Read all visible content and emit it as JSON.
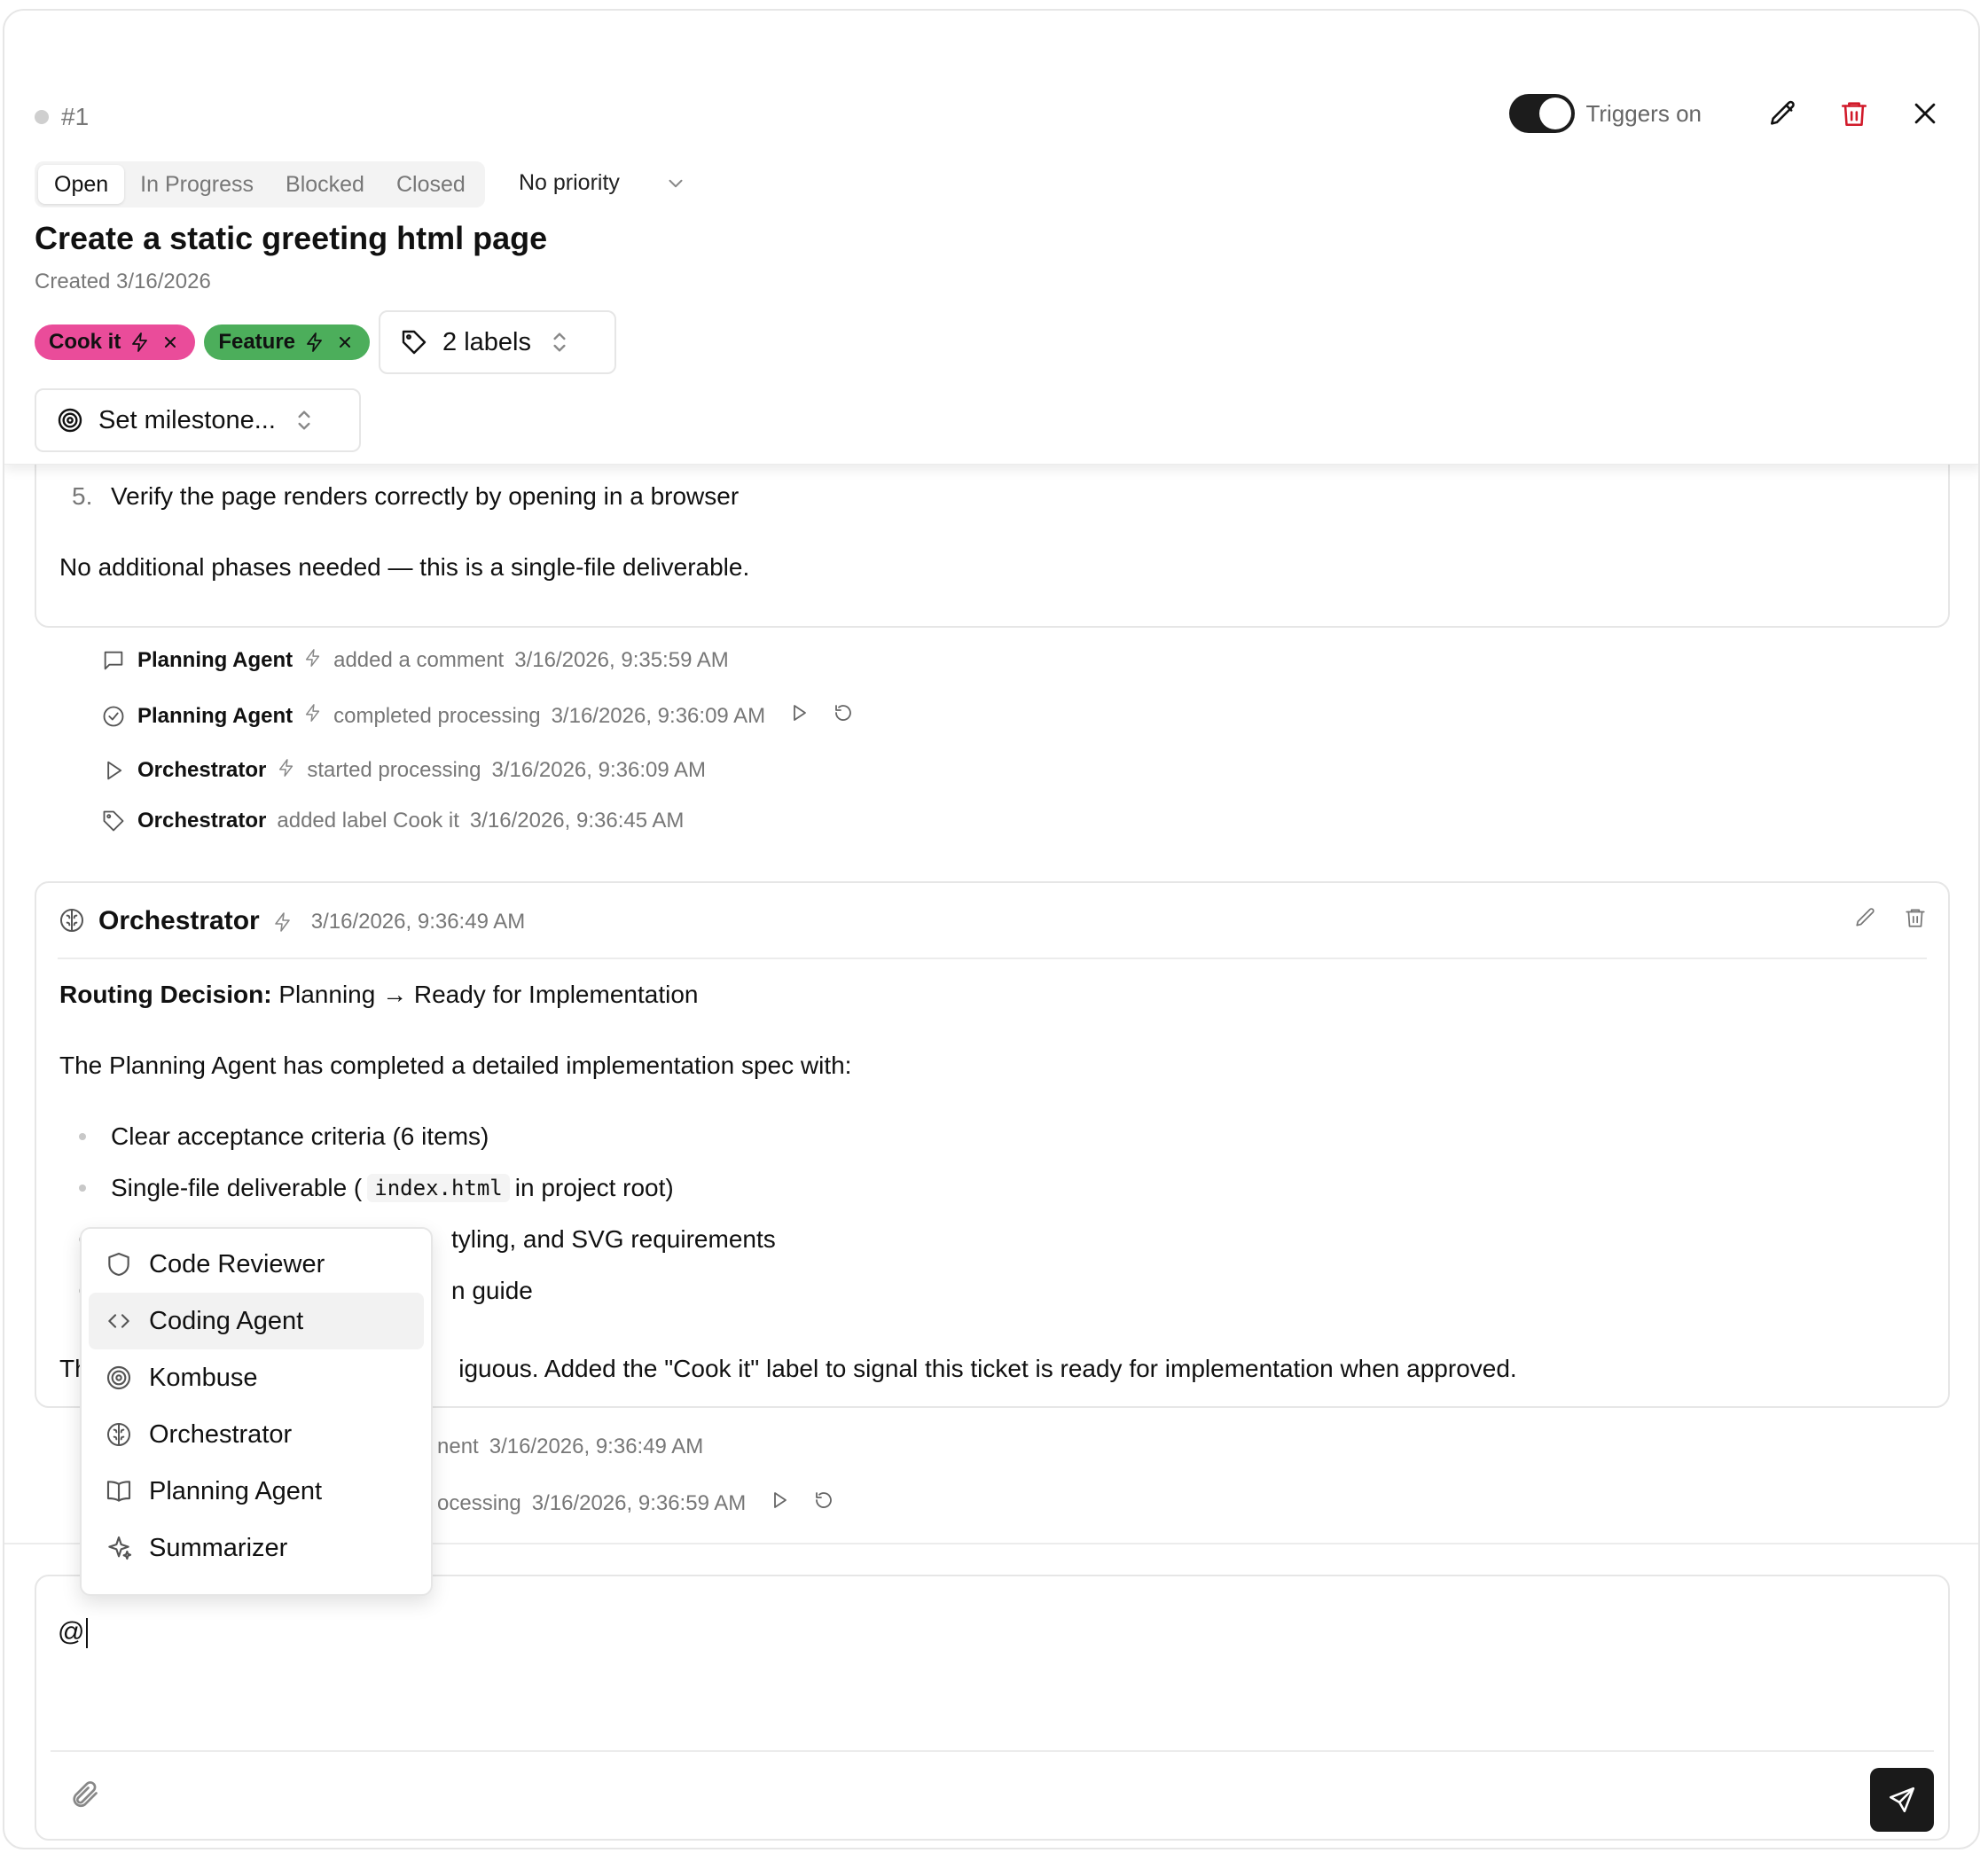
{
  "issue": {
    "id": "#1",
    "title": "Create a static greeting html page",
    "created": "Created 3/16/2026",
    "status_tabs": [
      "Open",
      "In Progress",
      "Blocked",
      "Closed"
    ],
    "active_status": "Open",
    "priority": "No priority"
  },
  "header": {
    "triggers_label": "Triggers on",
    "triggers_on": true
  },
  "labels": {
    "chips": [
      {
        "label": "Cook it",
        "color": "#ea4c9a"
      },
      {
        "label": "Feature",
        "color": "#4cae5b"
      }
    ],
    "summary": "2 labels"
  },
  "milestone": {
    "placeholder": "Set milestone..."
  },
  "plan_card": {
    "list_number": "5.",
    "list_text": "Verify the page renders correctly by opening in a browser",
    "closing": "No additional phases needed — this is a single-file deliverable."
  },
  "activity": [
    {
      "actor": "Planning Agent",
      "action": "added a comment",
      "time": "3/16/2026, 9:35:59 AM",
      "icon": "comment-icon"
    },
    {
      "actor": "Planning Agent",
      "action": "completed processing",
      "time": "3/16/2026, 9:36:09 AM",
      "icon": "check-circle-icon"
    },
    {
      "actor": "Orchestrator",
      "action": "started processing",
      "time": "3/16/2026, 9:36:09 AM",
      "icon": "play-icon"
    },
    {
      "actor": "Orchestrator",
      "action": "added label Cook it",
      "time": "3/16/2026, 9:36:45 AM",
      "icon": "tag-icon"
    }
  ],
  "comment": {
    "author": "Orchestrator",
    "time": "3/16/2026, 9:36:49 AM",
    "routing_label": "Routing Decision:",
    "routing_value": "Planning → Ready for Implementation",
    "intro": "The Planning Agent has completed a detailed implementation spec with:",
    "bullet1": "Clear acceptance criteria (6 items)",
    "bullet2_pre": "Single-file deliverable (",
    "bullet2_code": "index.html",
    "bullet2_post": "in project root)",
    "bullet3_visible": "tyling, and SVG requirements",
    "bullet4_visible": "n guide",
    "closing_prefix": "Th",
    "closing_visible": "iguous. Added the \"Cook it\" label to signal this ticket is ready for implementation when approved."
  },
  "activity_after": [
    {
      "visible": "nent",
      "time": "3/16/2026, 9:36:49 AM"
    },
    {
      "visible": "ocessing",
      "time": "3/16/2026, 9:36:59 AM"
    }
  ],
  "composer": {
    "value": "@"
  },
  "mention_menu": {
    "items": [
      {
        "label": "Code Reviewer",
        "icon": "shield-icon"
      },
      {
        "label": "Coding Agent",
        "icon": "code-icon"
      },
      {
        "label": "Kombuse",
        "icon": "target-icon"
      },
      {
        "label": "Orchestrator",
        "icon": "brain-icon"
      },
      {
        "label": "Planning Agent",
        "icon": "book-icon"
      },
      {
        "label": "Summarizer",
        "icon": "sparkles-icon"
      }
    ],
    "highlighted": "Coding Agent"
  },
  "colors": {
    "accent_dark": "#1a1a1a",
    "delete_red": "#d11a2a",
    "border": "#e6e6e6"
  }
}
